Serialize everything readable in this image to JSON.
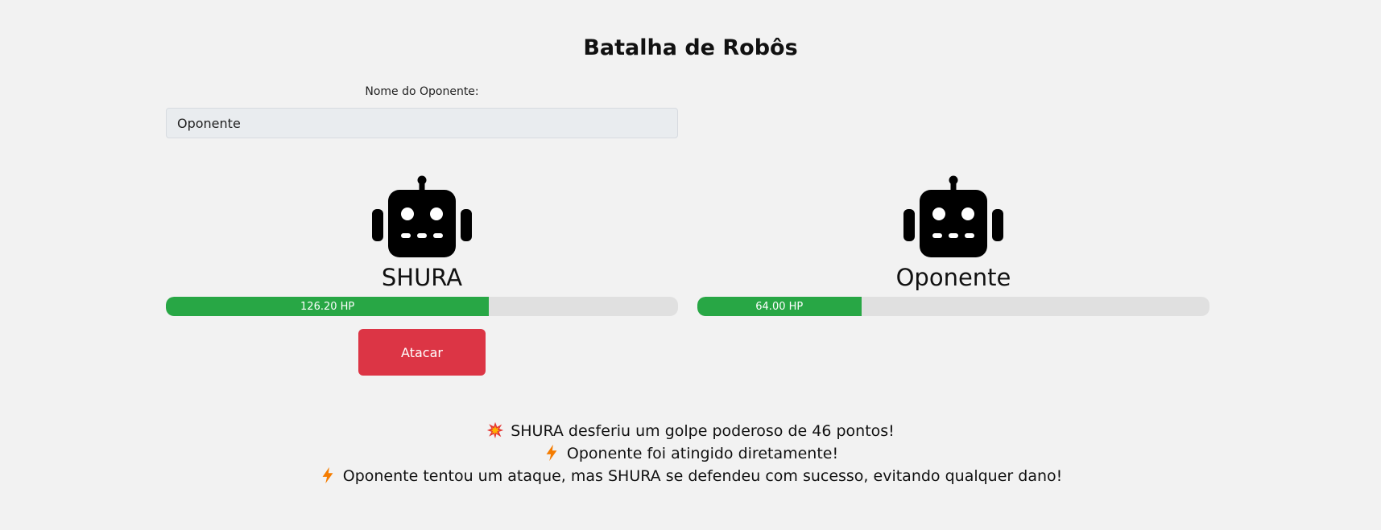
{
  "title": "Batalha de Robôs",
  "opponent_name": {
    "label": "Nome do Oponente:",
    "value": "Oponente"
  },
  "player": {
    "name": "SHURA",
    "hp_text": "126.20 HP",
    "hp_fraction": 0.631,
    "icon": "robot-icon",
    "attack_label": "Atacar"
  },
  "opponent": {
    "name": "Oponente",
    "hp_text": "64.00 HP",
    "hp_fraction": 0.32,
    "icon": "robot-icon"
  },
  "colors": {
    "hp_fill": "#28a745",
    "attack_button": "#dc3545",
    "background": "#f2f2f2"
  },
  "log": [
    {
      "icon": "explosion-icon",
      "text": "SHURA desferiu um golpe poderoso de 46 pontos!"
    },
    {
      "icon": "lightning-icon",
      "text": "Oponente foi atingido diretamente!"
    },
    {
      "icon": "lightning-icon",
      "text": "Oponente tentou um ataque, mas SHURA se defendeu com sucesso, evitando qualquer dano!"
    }
  ]
}
